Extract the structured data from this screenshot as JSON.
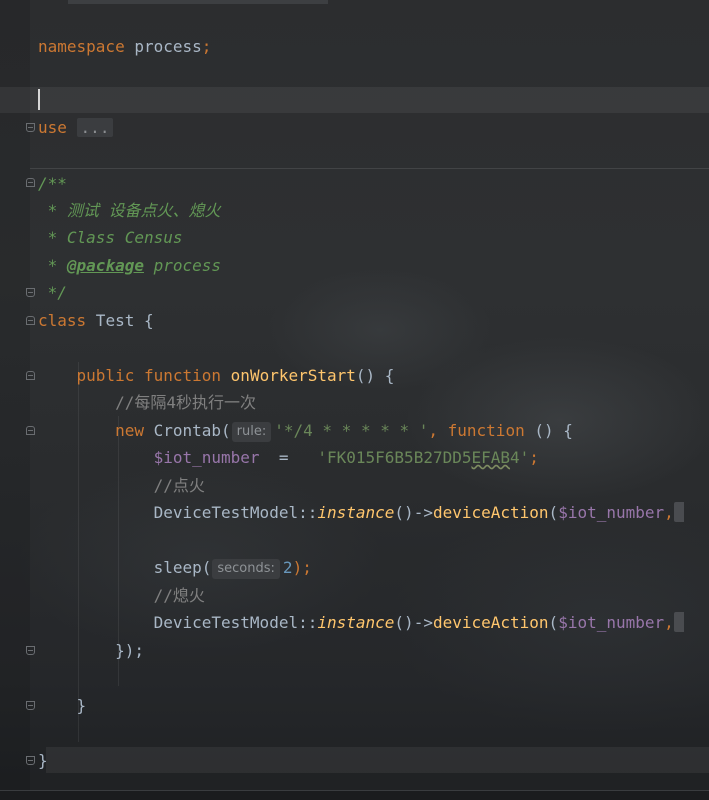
{
  "code": {
    "namespace_kw": "namespace",
    "namespace_name": "process",
    "semicolon": ";",
    "use_kw": "use",
    "use_folded": "...",
    "doc_open": "/**",
    "doc_line1": " * 测试 设备点火、熄火",
    "doc_line2": " * Class Census",
    "doc_star": " * ",
    "doc_tag": "@package",
    "doc_tag_value": " process",
    "doc_close": " */",
    "class_kw": "class",
    "class_name": " Test {",
    "public_kw": "public",
    "function_kw": "function",
    "method_name": "onWorkerStart",
    "method_tail": "() {",
    "comment_every4": "//每隔4秒执行一次",
    "new_kw": "new",
    "crontab_call": " Crontab(",
    "rule_hint": "rule:",
    "rule_value": "'*/4 * * * * * '",
    "comma": ", ",
    "closure_kw": "function",
    "closure_tail": " () {",
    "iot_var": "$iot_number",
    "assign": "  =   ",
    "iot_value_a": "'FK015F6B5B27DD5",
    "iot_value_b": "EFAB",
    "iot_value_c": "4'",
    "comment_ignite": "//点火",
    "model_class": "DeviceTestModel::",
    "instance_call": "instance",
    "arrow": "()->",
    "device_action": "deviceAction",
    "open_paren": "(",
    "sleep_call": "sleep(",
    "seconds_hint": "seconds:",
    "sleep_value": "2",
    "sleep_tail": ");",
    "comment_extinguish": "//熄火",
    "closure_close": "});",
    "method_close": "}",
    "class_close": "}"
  }
}
